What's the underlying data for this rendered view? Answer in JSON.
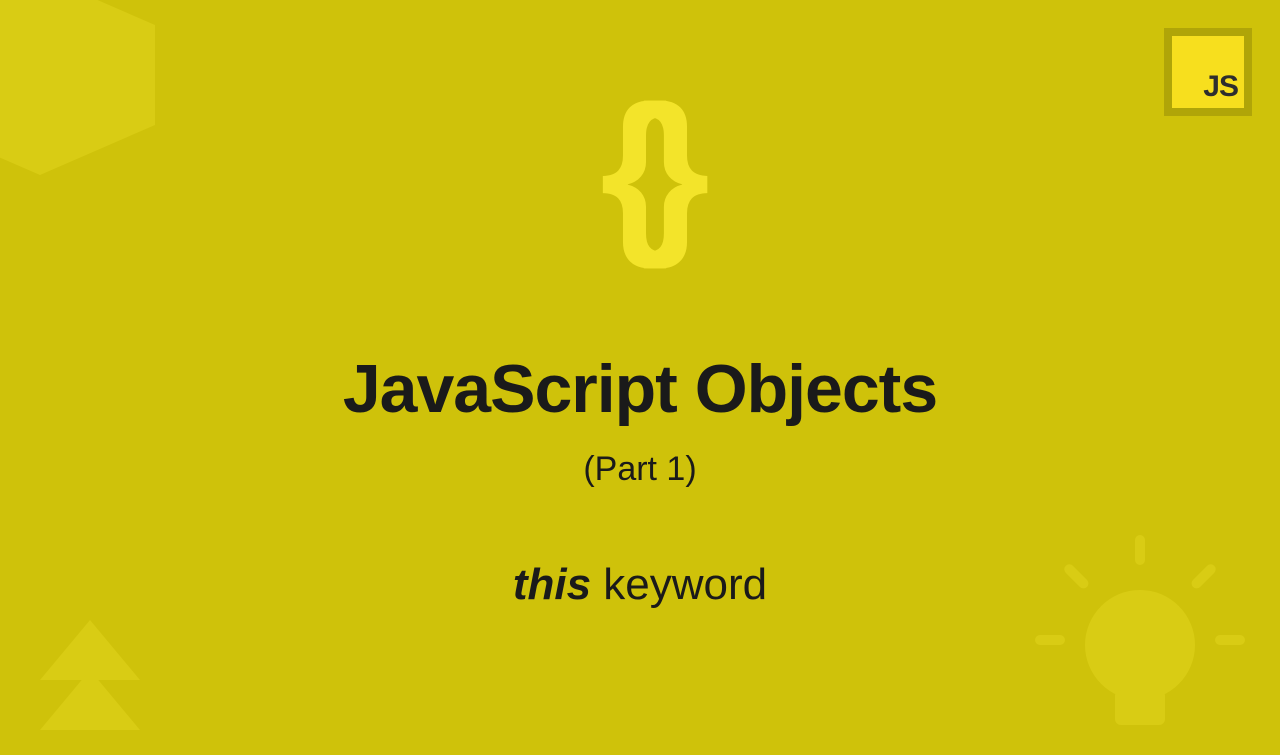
{
  "badge": {
    "label": "JS"
  },
  "braces": "{}",
  "title": "JavaScript Objects",
  "part": "(Part 1)",
  "subtitle": {
    "emphasis": "this",
    "rest": " keyword"
  }
}
